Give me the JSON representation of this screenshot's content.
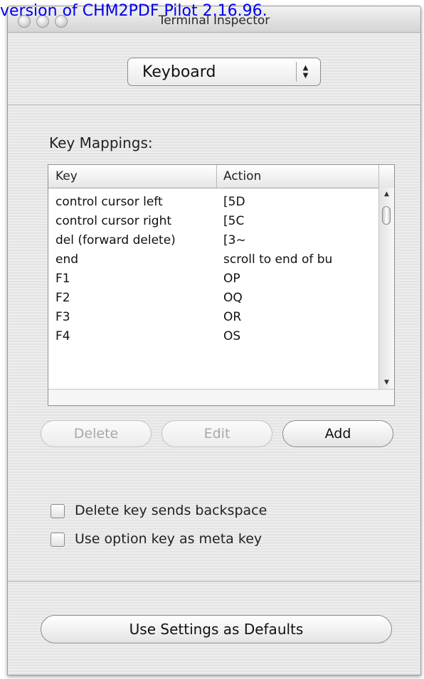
{
  "watermark": "version of CHM2PDF Pilot 2.16.96.",
  "window": {
    "title": "Terminal Inspector"
  },
  "panel_popup": {
    "selected": "Keyboard"
  },
  "key_mappings": {
    "label": "Key Mappings:",
    "columns": [
      "Key",
      "Action"
    ],
    "rows": [
      {
        "key": "control cursor left",
        "action": "[5D"
      },
      {
        "key": "control cursor right",
        "action": "[5C"
      },
      {
        "key": "del (forward delete)",
        "action": "[3~"
      },
      {
        "key": "end",
        "action": "scroll to end of bu"
      },
      {
        "key": "F1",
        "action": "OP"
      },
      {
        "key": "F2",
        "action": "OQ"
      },
      {
        "key": "F3",
        "action": "OR"
      },
      {
        "key": "F4",
        "action": "OS"
      }
    ]
  },
  "buttons": {
    "delete": "Delete",
    "edit": "Edit",
    "add": "Add",
    "use_defaults": "Use Settings as Defaults"
  },
  "options": {
    "delete_backspace": {
      "label": "Delete key sends backspace",
      "checked": false
    },
    "option_meta": {
      "label": "Use option key as meta key",
      "checked": false
    }
  }
}
